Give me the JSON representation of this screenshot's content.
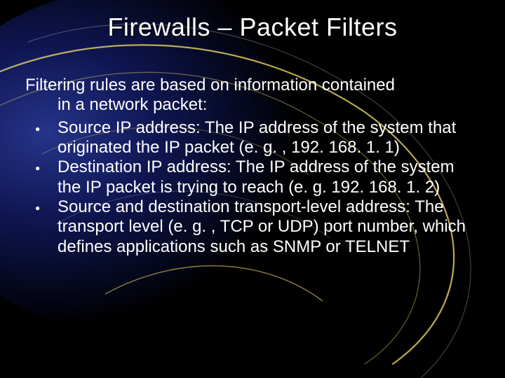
{
  "title": "Firewalls – Packet Filters",
  "intro_first": "Filtering rules are based on information contained",
  "intro_hang": "in a network packet:",
  "bullets": [
    "Source IP address: The IP address of the system that originated the IP packet (e. g. , 192. 168. 1. 1)",
    "Destination IP address: The IP address of the system the IP packet is trying to reach (e. g. 192. 168. 1. 2)",
    "Source and destination transport-level address: The transport level (e. g. , TCP or UDP) port number, which defines applications such as SNMP or TELNET"
  ]
}
